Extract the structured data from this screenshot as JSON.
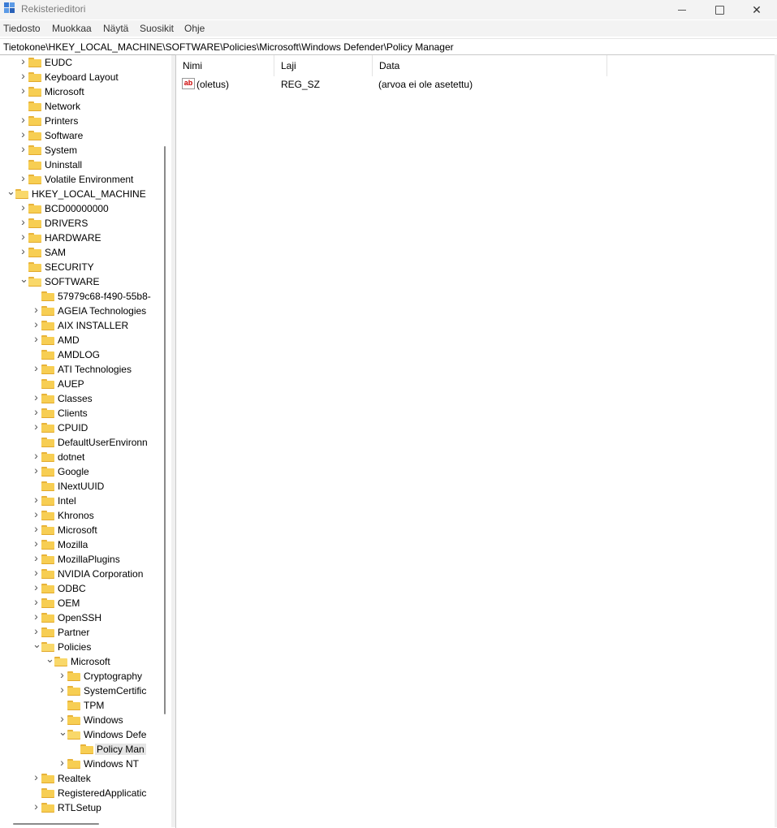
{
  "window": {
    "title": "Rekisterieditori",
    "icon": "registry-editor-icon"
  },
  "menu": [
    "Tiedosto",
    "Muokkaa",
    "Näytä",
    "Suosikit",
    "Ohje"
  ],
  "address": "Tietokone\\HKEY_LOCAL_MACHINE\\SOFTWARE\\Policies\\Microsoft\\Windows Defender\\Policy Manager",
  "tree": [
    {
      "label": "EUDC",
      "depth": 2,
      "expander": "collapsed"
    },
    {
      "label": "Keyboard Layout",
      "depth": 2,
      "expander": "collapsed"
    },
    {
      "label": "Microsoft",
      "depth": 2,
      "expander": "collapsed"
    },
    {
      "label": "Network",
      "depth": 2,
      "expander": "none"
    },
    {
      "label": "Printers",
      "depth": 2,
      "expander": "collapsed"
    },
    {
      "label": "Software",
      "depth": 2,
      "expander": "collapsed"
    },
    {
      "label": "System",
      "depth": 2,
      "expander": "collapsed"
    },
    {
      "label": "Uninstall",
      "depth": 2,
      "expander": "none"
    },
    {
      "label": "Volatile Environment",
      "depth": 2,
      "expander": "collapsed"
    },
    {
      "label": "HKEY_LOCAL_MACHINE",
      "depth": 1,
      "expander": "expanded"
    },
    {
      "label": "BCD00000000",
      "depth": 2,
      "expander": "collapsed"
    },
    {
      "label": "DRIVERS",
      "depth": 2,
      "expander": "collapsed"
    },
    {
      "label": "HARDWARE",
      "depth": 2,
      "expander": "collapsed"
    },
    {
      "label": "SAM",
      "depth": 2,
      "expander": "collapsed"
    },
    {
      "label": "SECURITY",
      "depth": 2,
      "expander": "none"
    },
    {
      "label": "SOFTWARE",
      "depth": 2,
      "expander": "expanded"
    },
    {
      "label": "57979c68-f490-55b8-",
      "depth": 3,
      "expander": "none"
    },
    {
      "label": "AGEIA Technologies",
      "depth": 3,
      "expander": "collapsed"
    },
    {
      "label": "AIX INSTALLER",
      "depth": 3,
      "expander": "collapsed"
    },
    {
      "label": "AMD",
      "depth": 3,
      "expander": "collapsed"
    },
    {
      "label": "AMDLOG",
      "depth": 3,
      "expander": "none"
    },
    {
      "label": "ATI Technologies",
      "depth": 3,
      "expander": "collapsed"
    },
    {
      "label": "AUEP",
      "depth": 3,
      "expander": "none"
    },
    {
      "label": "Classes",
      "depth": 3,
      "expander": "collapsed"
    },
    {
      "label": "Clients",
      "depth": 3,
      "expander": "collapsed"
    },
    {
      "label": "CPUID",
      "depth": 3,
      "expander": "collapsed"
    },
    {
      "label": "DefaultUserEnvironn",
      "depth": 3,
      "expander": "none"
    },
    {
      "label": "dotnet",
      "depth": 3,
      "expander": "collapsed"
    },
    {
      "label": "Google",
      "depth": 3,
      "expander": "collapsed"
    },
    {
      "label": "INextUUID",
      "depth": 3,
      "expander": "none"
    },
    {
      "label": "Intel",
      "depth": 3,
      "expander": "collapsed"
    },
    {
      "label": "Khronos",
      "depth": 3,
      "expander": "collapsed"
    },
    {
      "label": "Microsoft",
      "depth": 3,
      "expander": "collapsed"
    },
    {
      "label": "Mozilla",
      "depth": 3,
      "expander": "collapsed"
    },
    {
      "label": "MozillaPlugins",
      "depth": 3,
      "expander": "collapsed"
    },
    {
      "label": "NVIDIA Corporation",
      "depth": 3,
      "expander": "collapsed"
    },
    {
      "label": "ODBC",
      "depth": 3,
      "expander": "collapsed"
    },
    {
      "label": "OEM",
      "depth": 3,
      "expander": "collapsed"
    },
    {
      "label": "OpenSSH",
      "depth": 3,
      "expander": "collapsed"
    },
    {
      "label": "Partner",
      "depth": 3,
      "expander": "collapsed"
    },
    {
      "label": "Policies",
      "depth": 3,
      "expander": "expanded"
    },
    {
      "label": "Microsoft",
      "depth": 4,
      "expander": "expanded"
    },
    {
      "label": "Cryptography",
      "depth": 5,
      "expander": "collapsed"
    },
    {
      "label": "SystemCertific",
      "depth": 5,
      "expander": "collapsed"
    },
    {
      "label": "TPM",
      "depth": 5,
      "expander": "none"
    },
    {
      "label": "Windows",
      "depth": 5,
      "expander": "collapsed"
    },
    {
      "label": "Windows Defe",
      "depth": 5,
      "expander": "expanded"
    },
    {
      "label": "Policy Man",
      "depth": 6,
      "expander": "none",
      "selected": true
    },
    {
      "label": "Windows NT",
      "depth": 5,
      "expander": "collapsed"
    },
    {
      "label": "Realtek",
      "depth": 3,
      "expander": "collapsed"
    },
    {
      "label": "RegisteredApplicatic",
      "depth": 3,
      "expander": "none"
    },
    {
      "label": "RTLSetup",
      "depth": 3,
      "expander": "collapsed"
    }
  ],
  "columns": {
    "name": "Nimi",
    "type": "Laji",
    "data": "Data"
  },
  "values": [
    {
      "name": "(oletus)",
      "type": "REG_SZ",
      "data": "(arvoa ei ole asetettu)",
      "icon": "string-value-icon",
      "icon_text": "ab"
    }
  ]
}
